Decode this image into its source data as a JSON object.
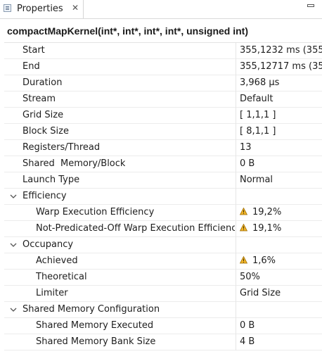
{
  "tab": {
    "label": "Properties"
  },
  "kernel_title": "compactMapKernel(int*, int*, int*, int*, unsigned int)",
  "rows": [
    {
      "name": "Start",
      "value": "355,1232 ms (355"
    },
    {
      "name": "End",
      "value": "355,12717 ms (35"
    },
    {
      "name": "Duration",
      "value": "3,968 µs"
    },
    {
      "name": "Stream",
      "value": "Default"
    },
    {
      "name": "Grid Size",
      "value": "[ 1,1,1 ]"
    },
    {
      "name": "Block Size",
      "value": "[ 8,1,1 ]"
    },
    {
      "name": "Registers/Thread",
      "value": "13"
    },
    {
      "name": "Shared  Memory/Block",
      "value": "0 B"
    },
    {
      "name": "Launch Type",
      "value": "Normal"
    },
    {
      "name": "Efficiency",
      "value": ""
    },
    {
      "name": "Warp Execution Efficiency",
      "value": "19,2%"
    },
    {
      "name": "Not-Predicated-Off Warp Execution Efficiency",
      "value": "19,1%"
    },
    {
      "name": "Occupancy",
      "value": ""
    },
    {
      "name": "Achieved",
      "value": "1,6%"
    },
    {
      "name": "Theoretical",
      "value": "50%"
    },
    {
      "name": "Limiter",
      "value": "Grid Size"
    },
    {
      "name": "Shared Memory Configuration",
      "value": ""
    },
    {
      "name": "Shared Memory Executed",
      "value": "0 B"
    },
    {
      "name": "Shared Memory Bank Size",
      "value": "4 B"
    }
  ],
  "warning_color": "#e8a317"
}
